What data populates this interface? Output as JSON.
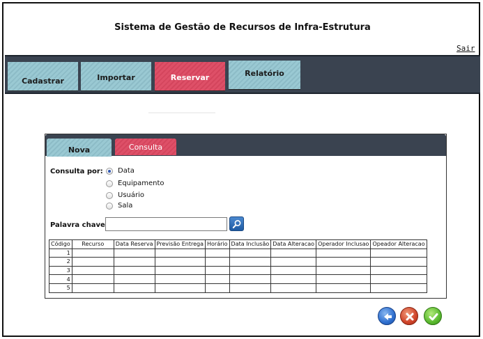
{
  "header": {
    "title": "Sistema de Gestão de Recursos de Infra-Estrutura",
    "logout": "Sair"
  },
  "nav": {
    "items": [
      {
        "label": "Cadastrar",
        "color": "#9ac9d3"
      },
      {
        "label": "Importar",
        "color": "#9ac9d3"
      },
      {
        "label": "Reservar",
        "color": "#de5068",
        "active": true
      },
      {
        "label": "Relatório",
        "color": "#9ac9d3"
      }
    ]
  },
  "panel": {
    "tabs": [
      {
        "label": "Nova",
        "active": true
      },
      {
        "label": "Consulta",
        "active": false
      }
    ],
    "query_label": "Consulta por:",
    "query_options": [
      {
        "label": "Data",
        "selected": true
      },
      {
        "label": "Equipamento",
        "selected": false
      },
      {
        "label": "Usuário",
        "selected": false
      },
      {
        "label": "Sala",
        "selected": false
      }
    ],
    "keyword_label": "Palavra chave:",
    "keyword_value": "",
    "search_icon": "magnifier-icon"
  },
  "table": {
    "columns": [
      "Código",
      "Recurso",
      "Data Reserva",
      "Previsão Entrega",
      "Horário",
      "Data Inclusão",
      "Data Alteracao",
      "Operador Inclusao",
      "Opeador Alteracao"
    ],
    "rows": [
      "1",
      "2",
      "3",
      "4",
      "5"
    ]
  },
  "actions": {
    "back_icon": "arrow-left-icon",
    "cancel_icon": "x-icon",
    "confirm_icon": "checkmark-icon"
  },
  "colors": {
    "nav_bg": "#3a4350",
    "tab_blue": "#9ac9d3",
    "tab_red": "#de5068"
  }
}
